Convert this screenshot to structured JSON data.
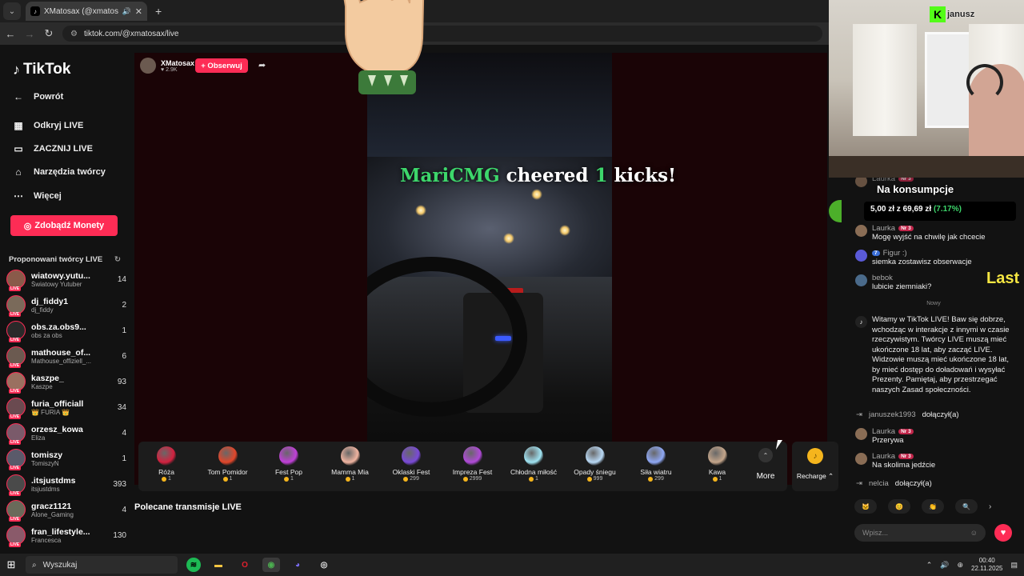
{
  "browser": {
    "tab_title": "XMatosax (@xmatosax) pro",
    "tab_close": "✕",
    "new_tab": "+",
    "url": "tiktok.com/@xmatosax/live"
  },
  "sidebar": {
    "logo": "TikTok",
    "back": "Powrót",
    "items": [
      {
        "label": "Odkryj LIVE",
        "icon": "calendar-icon"
      },
      {
        "label": "ZACZNIJ LIVE",
        "icon": "video-icon"
      },
      {
        "label": "Narzędzia twórcy",
        "icon": "house-icon"
      },
      {
        "label": "Więcej",
        "icon": "dots-icon"
      }
    ],
    "coins_button": "Zdobądź Monety",
    "suggested_title": "Proponowani twórcy LIVE",
    "creators": [
      {
        "name": "wiatowy.yutu...",
        "sub": "Światowy Yutuber",
        "count": "14"
      },
      {
        "name": "dj_fiddy1",
        "sub": "dj_fiddy",
        "count": "2"
      },
      {
        "name": "obs.za.obs9...",
        "sub": "obs za obs",
        "count": "1"
      },
      {
        "name": "mathouse_of...",
        "sub": "Mathouse_offiziell_...",
        "count": "6"
      },
      {
        "name": "kaszpe_",
        "sub": "Kaszpe",
        "count": "93"
      },
      {
        "name": "furia_officiall",
        "sub": "👑 FURIA 👑",
        "count": "34"
      },
      {
        "name": "orzesz_kowa",
        "sub": "Eliza",
        "count": "4"
      },
      {
        "name": "tomiszy",
        "sub": "TomiszyN",
        "count": "1"
      },
      {
        "name": ".itsjustdms",
        "sub": "itsjustdms",
        "count": "393"
      },
      {
        "name": "gracz1121",
        "sub": "Alone_Gaming",
        "count": "4"
      },
      {
        "name": "fran_lifestyle...",
        "sub": "Francesca",
        "count": "130"
      }
    ],
    "live_tag": "LIVE"
  },
  "stream": {
    "host_name": "XMatosax",
    "host_likes": "♥ 2.9K",
    "follow": "+ Obserwuj",
    "cheer_user": "MariCMG",
    "cheer_mid": " cheered ",
    "cheer_num": "1",
    "cheer_end": " kicks!"
  },
  "gifts": [
    {
      "name": "Róża",
      "price": "1",
      "color": "#d3213f"
    },
    {
      "name": "Tom Pomidor",
      "price": "1",
      "color": "#e2462a"
    },
    {
      "name": "Fest Pop",
      "price": "1",
      "color": "#c03fd8"
    },
    {
      "name": "Mamma Mia",
      "price": "1",
      "color": "#f0b4a0"
    },
    {
      "name": "Oklaski Fest",
      "price": "299",
      "color": "#7a4ad8"
    },
    {
      "name": "Impreza Fest",
      "price": "2999",
      "color": "#b04ad8"
    },
    {
      "name": "Chłodna miłość",
      "price": "1",
      "color": "#9fe3f2"
    },
    {
      "name": "Opady śniegu",
      "price": "999",
      "color": "#b9d9f5"
    },
    {
      "name": "Siła wiatru",
      "price": "299",
      "color": "#8fa8f5"
    },
    {
      "name": "Kawa",
      "price": "1",
      "color": "#c4a58a"
    }
  ],
  "gift_more": "More",
  "recharge": "Recharge ⌃",
  "recommended": "Polecane transmisje LIVE",
  "chat": {
    "overlay_title": "Na konsumpcje",
    "goal_prefix": "5,00 zł z 69,69 zł ",
    "goal_percent": "(7.17%)",
    "messages": [
      {
        "user": "Laurka",
        "badge": "Nr 3",
        "text": "Mogę wyjść na chwilę jak chcecie"
      },
      {
        "user": "Figur :)",
        "badge": "7",
        "text": "siemka zostawisz obserwacje"
      },
      {
        "user": "bebok",
        "badge": "",
        "text": "lubicie ziemniaki?"
      }
    ],
    "new_label": "Nowy",
    "system_message": "Witamy w TikTok LIVE! Baw się dobrze, wchodząc w interakcje z innymi w czasie rzeczywistym. Twórcy LIVE muszą mieć ukończone 18 lat, aby zacząć LIVE. Widzowie muszą mieć ukończone 18 lat, by mieć dostęp do doładowań i wysyłać Prezenty. Pamiętaj, aby przestrzegać naszych Zasad społeczności.",
    "joined1_user": "januszek1993",
    "joined_text": "dołączył(a)",
    "msg_przerywa": {
      "user": "Laurka",
      "badge": "Nr 3",
      "text": "Przerywa"
    },
    "msg_skolima": {
      "user": "Laurka",
      "badge": "Nr 3",
      "text": "Na skolima jedźcie"
    },
    "joined2_user": "nelcia",
    "input_placeholder": "Wpisz...",
    "overlay_last": "Last"
  },
  "webcam": {
    "kick_label": "janusz"
  },
  "taskbar": {
    "search": "Wyszukaj",
    "time": "00:40",
    "date": "22.11.2025"
  }
}
